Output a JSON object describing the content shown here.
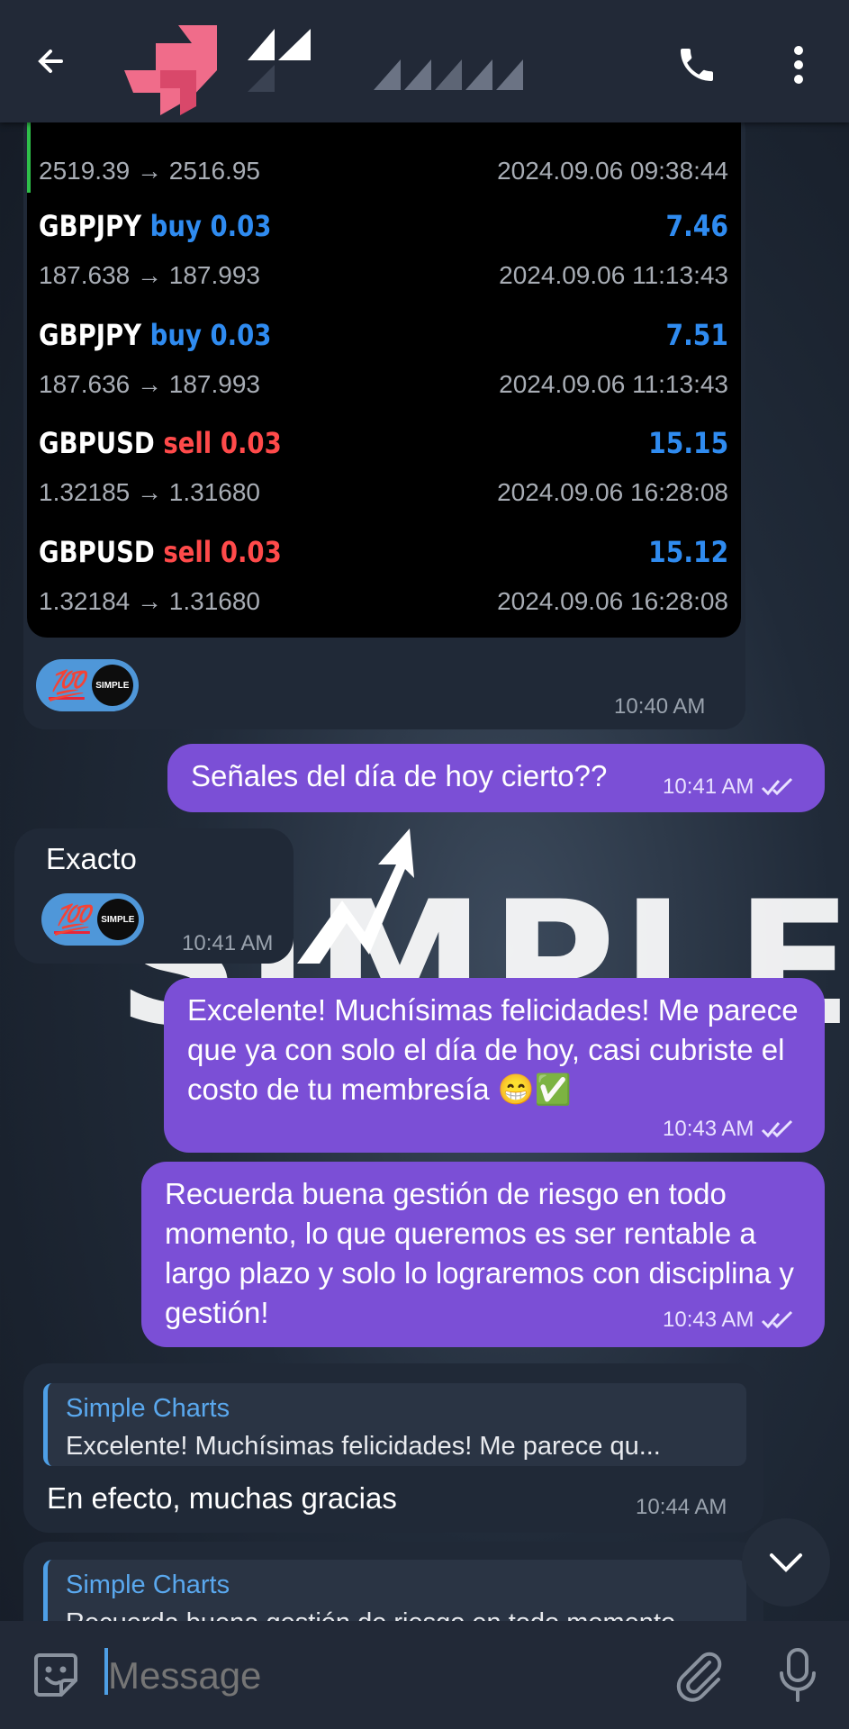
{
  "header": {
    "icons": [
      "back-arrow-icon",
      "phone-icon",
      "more-vertical-icon"
    ]
  },
  "trades": [
    {
      "symbol": "",
      "side": "",
      "side_class": "sell",
      "value": "",
      "price": "2519.39 → 2516.95",
      "date": "2024.09.06 09:38:44"
    },
    {
      "symbol": "GBPJPY",
      "side": "buy 0.03",
      "side_class": "buy",
      "value": "7.46",
      "price": "187.638 → 187.993",
      "date": "2024.09.06 11:13:43"
    },
    {
      "symbol": "GBPJPY",
      "side": "buy 0.03",
      "side_class": "buy",
      "value": "7.51",
      "price": "187.636 → 187.993",
      "date": "2024.09.06 11:13:43"
    },
    {
      "symbol": "GBPUSD",
      "side": "sell 0.03",
      "side_class": "sell",
      "value": "15.15",
      "price": "1.32185 → 1.31680",
      "date": "2024.09.06 16:28:08"
    },
    {
      "symbol": "GBPUSD",
      "side": "sell 0.03",
      "side_class": "sell",
      "value": "15.12",
      "price": "1.32184 → 1.31680",
      "date": "2024.09.06 16:28:08"
    }
  ],
  "card": {
    "reaction": "💯",
    "avatar_text": "SIMPLE",
    "time": "10:40 AM"
  },
  "messages": {
    "m1": {
      "text": "Señales del día de hoy cierto??",
      "time": "10:41 AM"
    },
    "m2": {
      "text": "Exacto",
      "reaction": "💯",
      "avatar_text": "SIMPLE",
      "time": "10:41 AM"
    },
    "m3": {
      "text": "Excelente! Muchísimas felicidades! Me parece que ya con solo el día de hoy, casi cubriste el costo de tu membresía 😁✅",
      "time": "10:43 AM"
    },
    "m4": {
      "text": "Recuerda buena gestión de riesgo en todo momento, lo que queremos es ser rentable a largo plazo y solo lo lograremos con disciplina y gestión!",
      "time": "10:43 AM"
    },
    "m5": {
      "reply_name": "Simple Charts",
      "reply_text": "Excelente! Muchísimas felicidades! Me parece qu...",
      "text": "En efecto, muchas gracias",
      "time": "10:44 AM"
    },
    "m6": {
      "reply_name": "Simple Charts",
      "reply_text": "Recuerda buena gestión de riesgo en todo momento"
    }
  },
  "background_word": "SIMPLE",
  "input": {
    "placeholder": "Message"
  },
  "colors": {
    "outgoing": "#7b4fd6",
    "incoming": "#202937",
    "buy": "#2f8bf0",
    "sell": "#ff4a4a",
    "accent": "#4e9fe6"
  }
}
